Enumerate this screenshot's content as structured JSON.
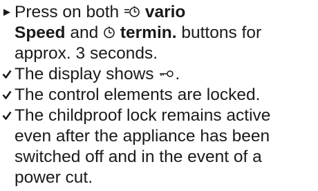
{
  "instructions": {
    "step": {
      "marker_icon": "triangle-arrow-icon",
      "part1": "Press on both",
      "vario_icon": "vario-speed-clock-icon",
      "vario_label": "vario",
      "speed_label": "Speed",
      "part2": "and",
      "termin_icon": "clock-icon",
      "termin_label": "termin.",
      "part3": "buttons for",
      "part4": "approx. 3 seconds."
    },
    "results": [
      {
        "marker_icon": "checkmark-icon",
        "text": "The display shows",
        "icon": "key-lock-icon",
        "suffix": "."
      },
      {
        "marker_icon": "checkmark-icon",
        "text": "The control elements are locked."
      },
      {
        "marker_icon": "checkmark-icon",
        "lines": [
          "The childproof lock remains active",
          "even after the appliance has been",
          "switched off and in the event of a",
          "power cut."
        ]
      }
    ]
  }
}
